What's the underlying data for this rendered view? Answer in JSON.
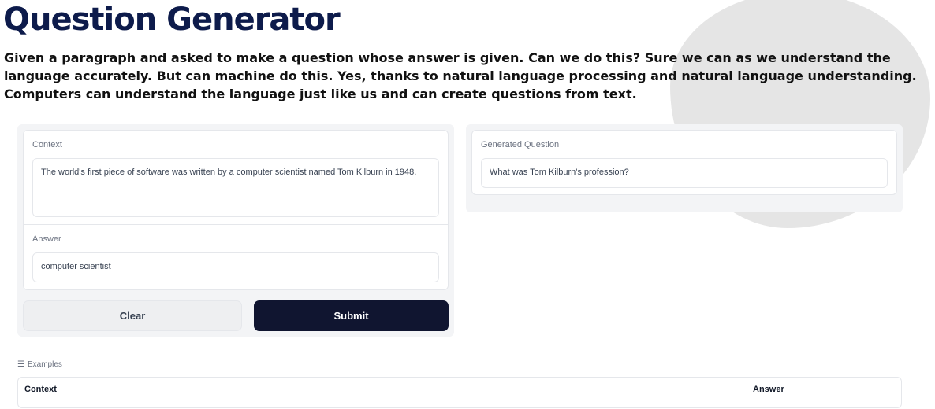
{
  "header": {
    "title": "Question Generator",
    "description": "Given a paragraph and asked to make a question whose answer is given. Can we do this? Sure we can as we understand the language accurately. But can machine do this. Yes, thanks to natural language processing and natural language understanding. Computers can understand the language just like us and can create questions from text."
  },
  "inputs": {
    "context_label": "Context",
    "context_value": "The world's first piece of software was written by a computer scientist named Tom Kilburn in 1948.",
    "answer_label": "Answer",
    "answer_value": "computer scientist",
    "clear_label": "Clear",
    "submit_label": "Submit"
  },
  "output": {
    "label": "Generated Question",
    "value": "What was Tom Kilburn's profession?"
  },
  "examples": {
    "label": "Examples",
    "columns": [
      "Context",
      "Answer"
    ]
  }
}
